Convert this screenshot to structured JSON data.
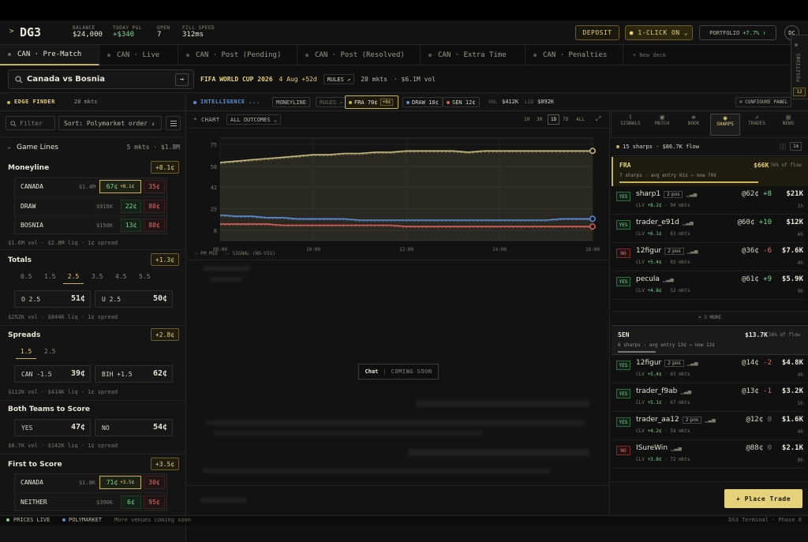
{
  "app": {
    "logo_arrow": ">",
    "logo": "DG3"
  },
  "stats": [
    {
      "label": "BALANCE",
      "value": "$24,000"
    },
    {
      "label": "TODAY P&L",
      "value": "+$340"
    },
    {
      "label": "OPEN",
      "value": "7"
    },
    {
      "label": "FILL SPEED",
      "value": "312ms"
    }
  ],
  "header": {
    "deposit": "DEPOSIT",
    "one_click": "● 1-CLICK ON ⌄",
    "portfolio_label": "PORTFOLIO",
    "portfolio_value": "+7.7% ↑",
    "avatar": "DC"
  },
  "tabs": [
    "CAN · Pre-Match",
    "CAN · Live",
    "CAN · Post (Pending)",
    "CAN · Post (Resolved)",
    "CAN · Extra Time",
    "CAN · Penalties",
    "+ New deck"
  ],
  "search": {
    "value": "Canada vs Bosnia",
    "go": "→"
  },
  "event": {
    "name": "FIFA WORLD CUP 2026",
    "date": "4 Aug +52d",
    "rules": "RULES ↗",
    "mkts": "28 mkts",
    "vol": "· $6.1M vol"
  },
  "edge": {
    "title": "EDGE FINDER",
    "count": "28 mkts",
    "filter": "Filter",
    "sort": "Sort: Polymarket order ↓"
  },
  "game_lines": {
    "title": "Game Lines",
    "meta": "5 mkts · $1.8M"
  },
  "moneyline": {
    "title": "Moneyline",
    "edge": "+8.1¢",
    "rows": [
      {
        "name": "CANADA",
        "vol": "$1.4M",
        "yes": "67¢",
        "yes_edge": "+8.1¢",
        "no": "35¢"
      },
      {
        "name": "DRAW",
        "vol": "$916K",
        "yes": "22¢",
        "no": "80¢"
      },
      {
        "name": "BOSNIA",
        "vol": "$150K",
        "yes": "13¢",
        "no": "88¢"
      }
    ],
    "foot": "$1.6M vol · $2.8M liq · 1¢ spread"
  },
  "totals": {
    "title": "Totals",
    "edge": "+1.3¢",
    "lines": [
      "0.5",
      "1.5",
      "2.5",
      "3.5",
      "4.5",
      "5.5"
    ],
    "over_label": "O 2.5",
    "over": "51¢",
    "under_label": "U 2.5",
    "under": "50¢",
    "foot": "$252K vol · $844K liq · 1¢ spread"
  },
  "spreads": {
    "title": "Spreads",
    "edge": "+2.8¢",
    "lines": [
      "1.5",
      "2.5"
    ],
    "a_label": "CAN -1.5",
    "a": "39¢",
    "b_label": "BIH +1.5",
    "b": "62¢",
    "foot": "$112K vol · $414K liq · 1¢ spread"
  },
  "btts": {
    "title": "Both Teams to Score",
    "yes_label": "YES",
    "yes": "47¢",
    "no_label": "NO",
    "no": "54¢",
    "foot": "$8.7K vol · $142K liq · 1¢ spread"
  },
  "first": {
    "title": "First to Score",
    "edge": "+3.5¢",
    "rows": [
      {
        "name": "CANADA",
        "vol": "$1.8K",
        "yes": "71¢",
        "yes_edge": "+3.5¢",
        "no": "30¢"
      },
      {
        "name": "NEITHER",
        "vol": "$390K",
        "yes": "6¢",
        "no": "95¢"
      }
    ]
  },
  "intel": {
    "title": "INTELLIGENCE ...",
    "moneyline": "MONEYLINE",
    "rules": "RULES ↗",
    "fra": "FRA 70¢",
    "fra_edge": "+8¢",
    "draw": "DRAW 18¢",
    "sen": "SEN 12¢",
    "vol_label": "VOL",
    "vol": "$412K",
    "liq_label": "LIQ",
    "liq": "$892K",
    "configure": "⌘ CONFIGURE PANEL"
  },
  "chart_bar": {
    "label": "CHART",
    "outcomes": "ALL OUTCOMES ⌄",
    "ranges": [
      "1H",
      "3H",
      "1D",
      "7D",
      "ALL"
    ],
    "active_range": "1D",
    "legend_mid": "PM MID",
    "legend_signal": "SIGNAL (NO-VIG)"
  },
  "chart_data": {
    "type": "line",
    "x": [
      "08:00",
      "10:00",
      "12:00",
      "14:00",
      "16:00"
    ],
    "ylim": [
      0,
      80
    ],
    "yticks": [
      8,
      25,
      42,
      58,
      75
    ],
    "series": [
      {
        "color": "#c9bd7e",
        "values": [
          61,
          62,
          63,
          64,
          65,
          66,
          67,
          67,
          68,
          68,
          69,
          69,
          70,
          70,
          70,
          70,
          69,
          70,
          70,
          70,
          70,
          70,
          70,
          70,
          70
        ]
      },
      {
        "color": "#5b8fd9",
        "values": [
          20,
          19,
          19,
          18,
          18,
          17,
          17,
          17,
          17,
          16,
          16,
          16,
          16,
          16,
          16,
          16,
          16,
          16,
          16,
          16,
          16,
          16,
          17,
          17,
          17
        ]
      },
      {
        "color": "#d9605b",
        "values": [
          13,
          13,
          13,
          13,
          12,
          12,
          12,
          12,
          12,
          12,
          12,
          12,
          11,
          11,
          11,
          11,
          11,
          11,
          11,
          11,
          11,
          11,
          11,
          11,
          11
        ]
      }
    ]
  },
  "chat": {
    "label": "Chat",
    "soon": "COMING SOON"
  },
  "right_tabs": [
    "SIGNALS",
    "MATCH",
    "BOOK",
    "SHARPS",
    "TRADES",
    "NEWS"
  ],
  "sharps": {
    "summary": "15 sharps · $86.7K flow",
    "window": "1m"
  },
  "fra_group": {
    "name": "FRA",
    "amount": "$66K",
    "share": "76% of flow",
    "desc": "7 sharps · avg entry 61¢ → now 70¢",
    "more": "▾ 3 MORE"
  },
  "sen_group": {
    "name": "SEN",
    "amount": "$13.7K",
    "share": "16% of flow",
    "desc": "6 sharps · avg entry 13¢ → now 12¢"
  },
  "traders_fra": [
    {
      "side": "YES",
      "name": "sharp1",
      "pos": "2 pos",
      "price": "@62¢",
      "delta": "+8",
      "amt": "$21K",
      "clv": "+8.2¢",
      "mkts": "· 94 mkts",
      "age": "1h"
    },
    {
      "side": "YES",
      "name": "trader_e91d",
      "price": "@60¢",
      "delta": "+10",
      "amt": "$12K",
      "clv": "+6.1¢",
      "mkts": "· 61 mkts",
      "age": "6h"
    },
    {
      "side": "NO",
      "name": "12figur",
      "pos": "2 pos",
      "price": "@36¢",
      "delta": "-6",
      "amt": "$7.6K",
      "clv": "+5.4¢",
      "mkts": "· 83 mkts",
      "age": "4h"
    },
    {
      "side": "YES",
      "name": "pecula",
      "price": "@61¢",
      "delta": "+9",
      "amt": "$5.9K",
      "clv": "+4.8¢",
      "mkts": "· 52 mkts",
      "age": "9h"
    }
  ],
  "traders_sen": [
    {
      "side": "YES",
      "name": "12figur",
      "pos": "2 pos",
      "price": "@14¢",
      "delta": "-2",
      "amt": "$4.8K",
      "clv": "+5.4¢",
      "mkts": "· 83 mkts",
      "age": "4h"
    },
    {
      "side": "YES",
      "name": "trader_f9ab",
      "price": "@13¢",
      "delta": "-1",
      "amt": "$3.2K",
      "clv": "+5.1¢",
      "mkts": "· 67 mkts",
      "age": "5h"
    },
    {
      "side": "YES",
      "name": "trader_aa12",
      "pos": "2 pos",
      "price": "@12¢",
      "delta": "0",
      "amt": "$1.6K",
      "clv": "+4.2¢",
      "mkts": "· 58 mkts",
      "age": "4h"
    },
    {
      "side": "NO",
      "name": "ISureWin",
      "price": "@88¢",
      "delta": "0",
      "amt": "$2.1K",
      "clv": "+3.8¢",
      "mkts": "· 72 mkts",
      "age": "8h"
    }
  ],
  "positions": {
    "label": "POSITIONS",
    "count": "12"
  },
  "place_trade": "+ Place Trade",
  "footer": {
    "live": "PRICES LIVE",
    "venue": "POLYMARKET",
    "more": "More venues coming soon",
    "brand": "DG3 Terminal · Phase 0"
  }
}
